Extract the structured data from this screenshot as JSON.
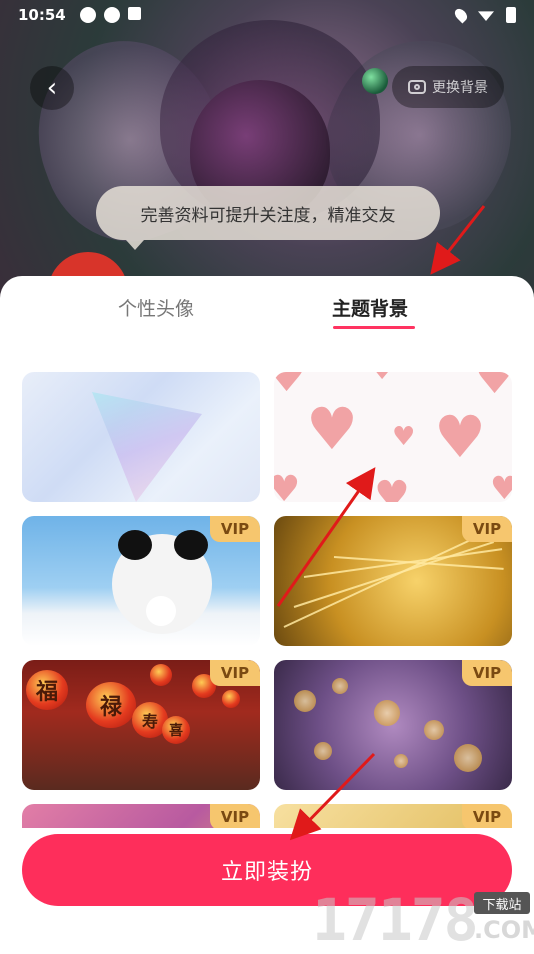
{
  "status_bar": {
    "time": "10:54"
  },
  "hero": {
    "change_background_label": "更换背景"
  },
  "tooltip": {
    "text": "完善资料可提升关注度，精准交友"
  },
  "tabs": [
    {
      "label": "个性头像",
      "active": false
    },
    {
      "label": "主题背景",
      "active": true
    }
  ],
  "themes": [
    {
      "name": "glass",
      "vip": false
    },
    {
      "name": "hearts",
      "vip": false
    },
    {
      "name": "panda",
      "vip": true,
      "badge": "VIP"
    },
    {
      "name": "wheat",
      "vip": true,
      "badge": "VIP"
    },
    {
      "name": "festival",
      "vip": true,
      "badge": "VIP",
      "lantern_texts": [
        "福",
        "禄",
        "寿",
        "喜"
      ]
    },
    {
      "name": "bokeh",
      "vip": true,
      "badge": "VIP"
    },
    {
      "name": "pink-feathers",
      "vip": true,
      "badge": "VIP"
    },
    {
      "name": "gold-glow",
      "vip": true,
      "badge": "VIP"
    }
  ],
  "cta": {
    "label": "立即装扮"
  },
  "colors": {
    "accent": "#fe2e5b",
    "tab_underline": "#ff3361",
    "vip_badge": "#f6c66e",
    "annotation_arrow": "#e01a1a"
  },
  "watermark": {
    "number": "17178",
    "tag": "下载站",
    "suffix": ".COM"
  }
}
